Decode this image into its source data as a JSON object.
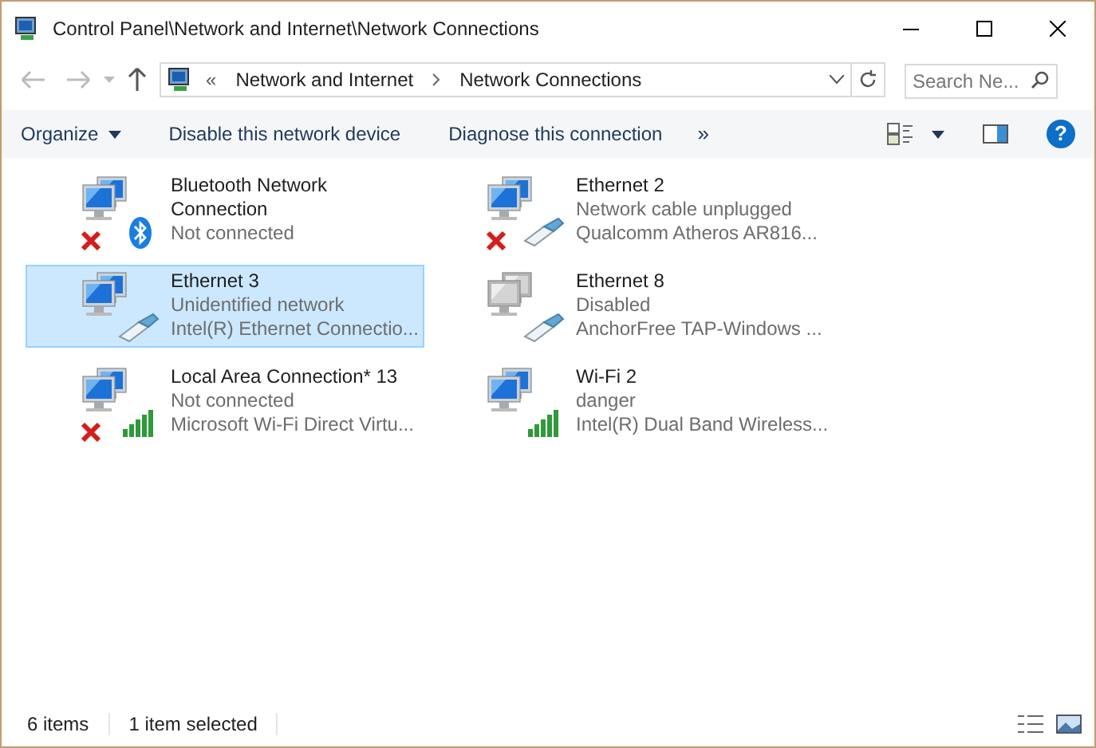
{
  "window": {
    "title": "Control Panel\\Network and Internet\\Network Connections"
  },
  "address_bar": {
    "overflow": "«",
    "segments": [
      "Network and Internet",
      "Network Connections"
    ]
  },
  "search": {
    "placeholder": "Search Ne..."
  },
  "toolbar": {
    "items": [
      {
        "label": "Organize",
        "dropdown": true
      },
      {
        "label": "Disable this network device",
        "dropdown": false
      },
      {
        "label": "Diagnose this connection",
        "dropdown": false
      }
    ],
    "more": "»",
    "help": "?"
  },
  "connections": [
    {
      "name": "Bluetooth Network Connection",
      "status": "Not connected",
      "kind": "bluetooth",
      "error": true,
      "disabled": false,
      "selected": false
    },
    {
      "name": "Ethernet 2",
      "status": "Network cable unplugged",
      "device": "Qualcomm Atheros AR816...",
      "kind": "ethernet",
      "error": true,
      "disabled": false,
      "selected": false
    },
    {
      "name": "Ethernet 3",
      "status": "Unidentified network",
      "device": "Intel(R) Ethernet Connectio...",
      "kind": "ethernet",
      "error": false,
      "disabled": false,
      "selected": true
    },
    {
      "name": "Ethernet 8",
      "status": "Disabled",
      "device": "AnchorFree TAP-Windows ...",
      "kind": "ethernet",
      "error": false,
      "disabled": true,
      "selected": false
    },
    {
      "name": "Local Area Connection* 13",
      "status": "Not connected",
      "device": "Microsoft Wi-Fi Direct Virtu...",
      "kind": "wifi",
      "error": true,
      "disabled": false,
      "selected": false
    },
    {
      "name": "Wi-Fi 2",
      "status": "danger",
      "device": "Intel(R) Dual Band Wireless...",
      "kind": "wifi",
      "error": false,
      "disabled": false,
      "selected": false
    }
  ],
  "status_bar": {
    "count": "6 items",
    "selection": "1 item selected"
  }
}
